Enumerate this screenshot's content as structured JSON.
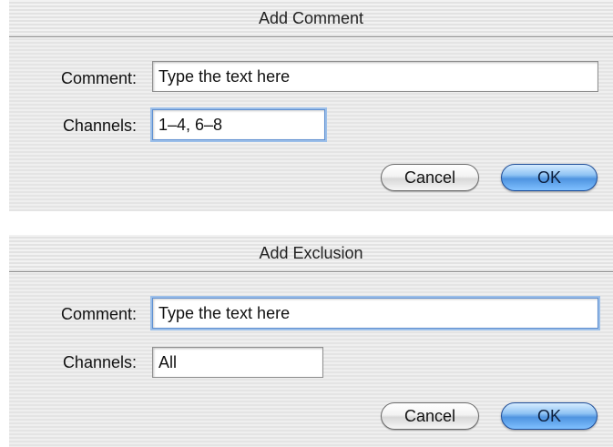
{
  "dialogs": [
    {
      "title": "Add Comment",
      "comment_label": "Comment:",
      "comment_value": "Type the text here",
      "channels_label": "Channels:",
      "channels_value": "1–4, 6–8",
      "cancel_label": "Cancel",
      "ok_label": "OK",
      "focused_field": "channels"
    },
    {
      "title": "Add Exclusion",
      "comment_label": "Comment:",
      "comment_value": "Type the text here",
      "channels_label": "Channels:",
      "channels_value": "All",
      "cancel_label": "Cancel",
      "ok_label": "OK",
      "focused_field": "comment"
    }
  ],
  "colors": {
    "focus_ring": "#9cbfe9",
    "default_button": "#4f94e0",
    "dialog_background": "#ededed"
  }
}
